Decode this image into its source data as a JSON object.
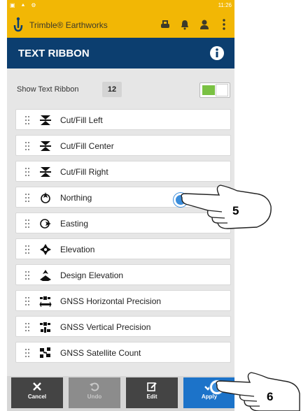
{
  "status_bar": {
    "left": "▣ ⯅ ⚙",
    "time": "11:26"
  },
  "app": {
    "title": "Trimble® Earthworks"
  },
  "page": {
    "title": "TEXT RIBBON"
  },
  "show_ribbon": {
    "label": "Show Text Ribbon",
    "count": "12",
    "enabled": true
  },
  "items": [
    {
      "label": "Cut/Fill Left",
      "icon": "cut-fill-icon"
    },
    {
      "label": "Cut/Fill Center",
      "icon": "cut-fill-icon"
    },
    {
      "label": "Cut/Fill Right",
      "icon": "cut-fill-icon"
    },
    {
      "label": "Northing",
      "icon": "northing-icon"
    },
    {
      "label": "Easting",
      "icon": "easting-icon"
    },
    {
      "label": "Elevation",
      "icon": "elevation-icon"
    },
    {
      "label": "Design Elevation",
      "icon": "design-elevation-icon"
    },
    {
      "label": "GNSS Horizontal Precision",
      "icon": "gnss-horizontal-icon"
    },
    {
      "label": "GNSS Vertical Precision",
      "icon": "gnss-vertical-icon"
    },
    {
      "label": "GNSS Satellite Count",
      "icon": "satellite-icon"
    }
  ],
  "buttons": {
    "cancel": "Cancel",
    "undo": "Undo",
    "edit": "Edit",
    "apply": "Apply"
  },
  "callouts": {
    "step5": "5",
    "step6": "6"
  },
  "colors": {
    "app_bar": "#f2b705",
    "title_bar": "#0c3e6f",
    "apply": "#1c73c9",
    "toggle_on": "#7ac143"
  }
}
